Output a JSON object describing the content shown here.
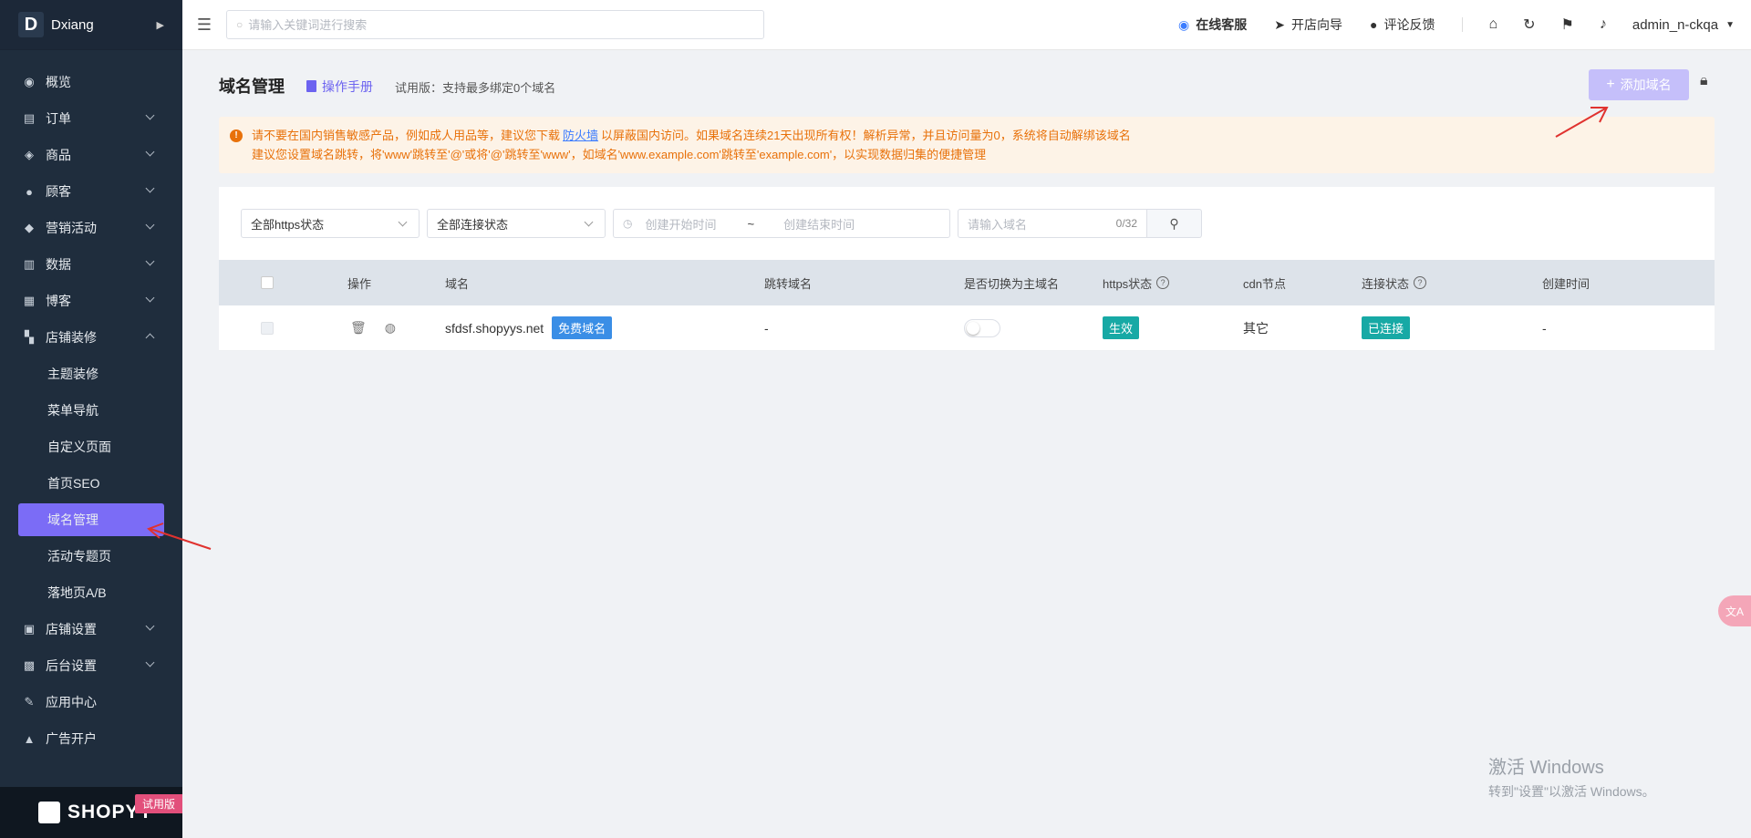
{
  "brand": {
    "logo_letter": "D",
    "name": "Dxiang"
  },
  "sidebar": {
    "items": [
      {
        "label": "概览",
        "icon": "gauge-icon",
        "expandable": false
      },
      {
        "label": "订单",
        "icon": "order-icon",
        "expandable": true
      },
      {
        "label": "商品",
        "icon": "box-icon",
        "expandable": true
      },
      {
        "label": "顾客",
        "icon": "user-icon",
        "expandable": true
      },
      {
        "label": "营销活动",
        "icon": "tag-icon",
        "expandable": true
      },
      {
        "label": "数据",
        "icon": "bar-chart-icon",
        "expandable": true
      },
      {
        "label": "博客",
        "icon": "blog-icon",
        "expandable": true
      },
      {
        "label": "店铺装修",
        "icon": "paint-roller-icon",
        "expandable": true,
        "expanded": true
      }
    ],
    "subitems": [
      "主题装修",
      "菜单导航",
      "自定义页面",
      "首页SEO",
      "域名管理",
      "活动专题页",
      "落地页A/B"
    ],
    "active_subitem": "域名管理",
    "items_after": [
      {
        "label": "店铺设置",
        "icon": "store-icon",
        "expandable": true
      },
      {
        "label": "后台设置",
        "icon": "admin-settings-icon",
        "expandable": true
      },
      {
        "label": "应用中心",
        "icon": "wrench-icon",
        "expandable": false
      },
      {
        "label": "广告开户",
        "icon": "ad-icon",
        "expandable": false
      }
    ],
    "footer": {
      "logo_text": "SHOPYY",
      "trial_tag": "试用版"
    }
  },
  "topbar": {
    "search_placeholder": "请输入关键词进行搜索",
    "links": [
      {
        "label": "在线客服",
        "icon": "support-icon"
      },
      {
        "label": "开店向导",
        "icon": "paper-plane-icon"
      },
      {
        "label": "评论反馈",
        "icon": "comment-icon"
      }
    ],
    "user": "admin_n-ckqa"
  },
  "page": {
    "title": "域名管理",
    "manual_label": "操作手册",
    "trial_note": "试用版：支持最多绑定0个域名",
    "add_button": "添加域名"
  },
  "notice": {
    "line1_before": "请不要在国内销售敏感产品，例如成人用品等，建议您下载",
    "line1_link": "防火墙",
    "line1_after": "以屏蔽国内访问。如果域名连续21天出现所有权！解析异常，并且访问量为0，系统将自动解绑该域名",
    "line2": "建议您设置域名跳转，将'www'跳转至'@'或将'@'跳转至'www'，如域名'www.example.com'跳转至'example.com'，以实现数据归集的便捷管理"
  },
  "filters": {
    "https_status": "全部https状态",
    "connect_status": "全部连接状态",
    "start_placeholder": "创建开始时间",
    "range_sep": "~",
    "end_placeholder": "创建结束时间",
    "domain_placeholder": "请输入域名",
    "domain_count": "0/32"
  },
  "table": {
    "headers": {
      "op": "操作",
      "domain": "域名",
      "redirect": "跳转域名",
      "switch_main": "是否切换为主域名",
      "https": "https状态",
      "cdn": "cdn节点",
      "connect": "连接状态",
      "created": "创建时间"
    },
    "rows": [
      {
        "domain": "sfdsf.shopyys.net",
        "free_badge": "免费域名",
        "redirect": "-",
        "switch_main": false,
        "https": "生效",
        "cdn": "其它",
        "connect": "已连接",
        "created": "-"
      }
    ]
  },
  "windows_watermark": {
    "line1": "激活 Windows",
    "line2": "转到\"设置\"以激活 Windows。"
  },
  "colors": {
    "sidebar_bg": "#1f2d3d",
    "accent": "#7b6cf6",
    "notice_text": "#e8710a",
    "badge_blue": "#3a8ee6",
    "badge_teal": "#17a9a5",
    "arrow": "#e0322f"
  }
}
